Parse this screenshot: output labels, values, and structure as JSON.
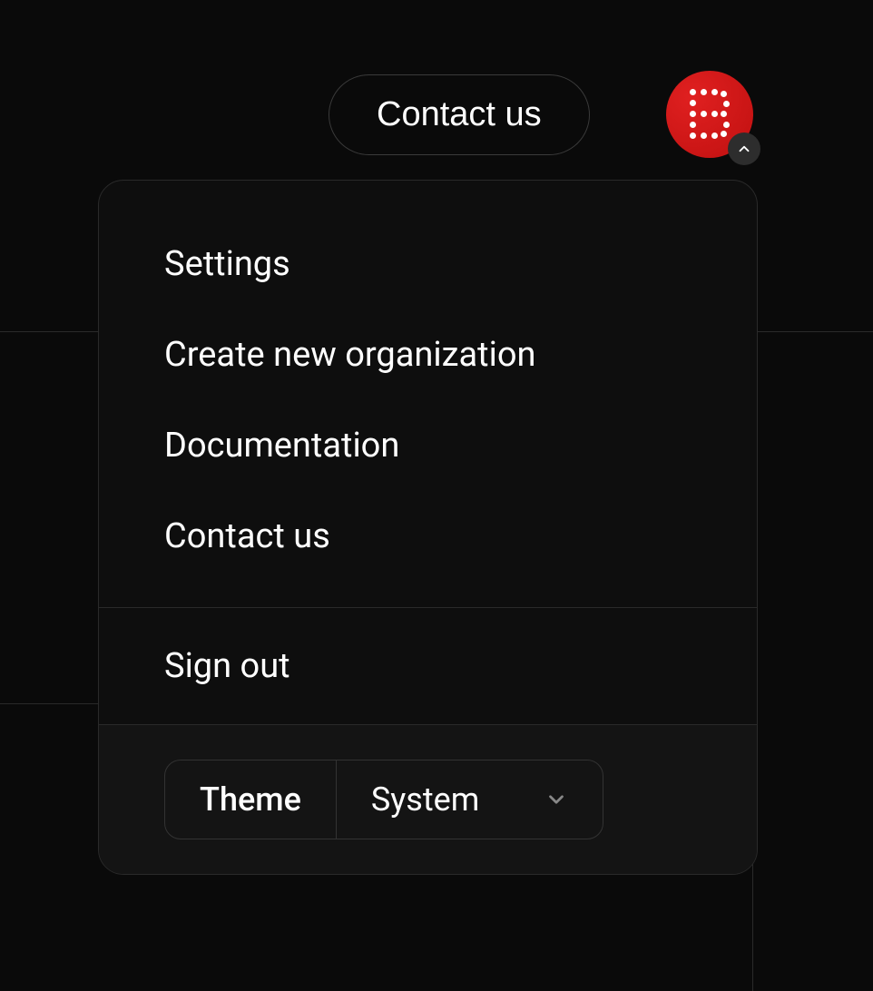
{
  "header": {
    "contact_button": "Contact us"
  },
  "dropdown": {
    "items": [
      {
        "label": "Settings"
      },
      {
        "label": "Create new organization"
      },
      {
        "label": "Documentation"
      },
      {
        "label": "Contact us"
      }
    ],
    "signout_label": "Sign out",
    "theme": {
      "label": "Theme",
      "value": "System"
    }
  }
}
